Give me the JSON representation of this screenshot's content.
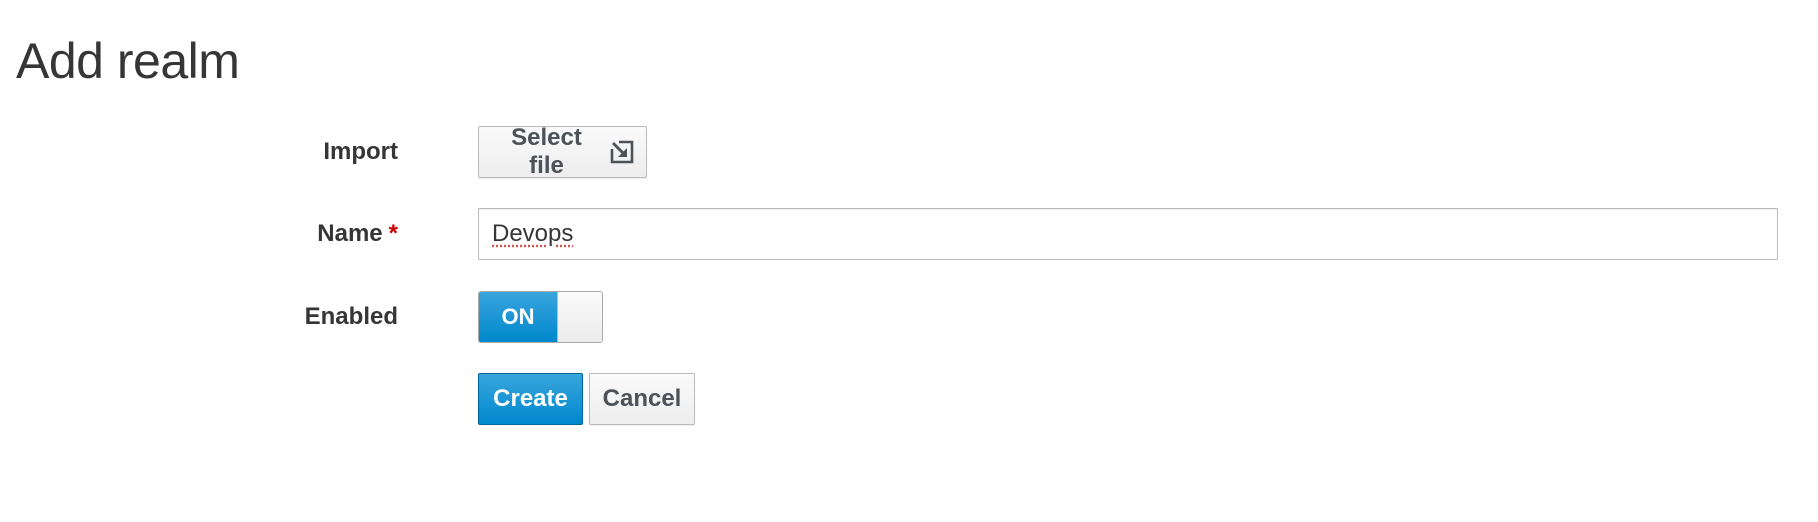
{
  "page": {
    "title": "Add realm"
  },
  "form": {
    "import": {
      "label": "Import",
      "button_label": "Select file",
      "icon": "import-file-icon"
    },
    "name": {
      "label": "Name",
      "required_marker": "*",
      "value": "Devops",
      "placeholder": ""
    },
    "enabled": {
      "label": "Enabled",
      "state_label": "ON",
      "checked": true
    },
    "actions": {
      "create_label": "Create",
      "cancel_label": "Cancel"
    }
  },
  "colors": {
    "primary": "#0088ce",
    "required": "#cc0000",
    "text": "#363636"
  }
}
